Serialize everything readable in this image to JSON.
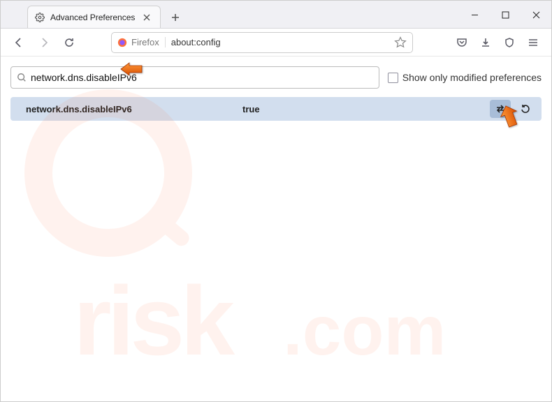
{
  "titlebar": {
    "tab_title": "Advanced Preferences"
  },
  "navbar": {
    "identity_label": "Firefox",
    "address": "about:config"
  },
  "config": {
    "search_value": "network.dns.disableIPv6",
    "show_modified_label": "Show only modified preferences",
    "pref_name": "network.dns.disableIPv6",
    "pref_value": "true"
  }
}
